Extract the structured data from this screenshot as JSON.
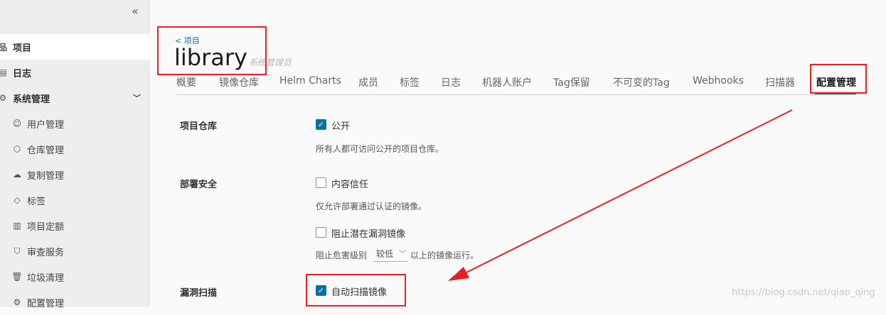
{
  "sidebar": {
    "collapse_icon": "double-chevron-left-icon",
    "items": [
      {
        "label": "项目",
        "icon": "projects-icon",
        "active": true
      },
      {
        "label": "日志",
        "icon": "logs-icon"
      },
      {
        "label": "系统管理",
        "icon": "gears-icon"
      }
    ],
    "sub_items": [
      {
        "label": "用户管理",
        "icon": "users-icon"
      },
      {
        "label": "仓库管理",
        "icon": "cube-icon"
      },
      {
        "label": "复制管理",
        "icon": "cloud-icon"
      },
      {
        "label": "标签",
        "icon": "tag-icon"
      },
      {
        "label": "项目定额",
        "icon": "quota-icon"
      },
      {
        "label": "审查服务",
        "icon": "shield-icon"
      },
      {
        "label": "垃圾清理",
        "icon": "trash-icon"
      },
      {
        "label": "配置管理",
        "icon": "gear-icon"
      }
    ]
  },
  "header": {
    "back_link": "< 项目",
    "title": "library",
    "role": "系统管理员"
  },
  "tabs": [
    {
      "label": "概要"
    },
    {
      "label": "镜像仓库"
    },
    {
      "label": "Helm Charts"
    },
    {
      "label": "成员"
    },
    {
      "label": "标签"
    },
    {
      "label": "日志"
    },
    {
      "label": "机器人账户"
    },
    {
      "label": "Tag保留"
    },
    {
      "label": "不可变的Tag"
    },
    {
      "label": "Webhooks"
    },
    {
      "label": "扫描器"
    },
    {
      "label": "配置管理",
      "active": true
    }
  ],
  "config": {
    "registry": {
      "label": "项目仓库",
      "checkbox_label": "公开",
      "checked": true,
      "help": "所有人都可访问公开的项目仓库。"
    },
    "deployment": {
      "label": "部署安全",
      "trust_label": "内容信任",
      "trust_checked": false,
      "trust_help": "仅允许部署通过认证的镜像。",
      "prevent_label": "阻止潜在漏洞镜像",
      "prevent_checked": false,
      "severity_prefix": "阻止危害级别",
      "severity_value": "较低",
      "severity_suffix": "以上的镜像运行。"
    },
    "scan": {
      "label": "漏洞扫描",
      "checkbox_label": "自动扫描镜像",
      "checked": true
    }
  },
  "watermark": "https://blog.csdn.net/qiao_qing",
  "colors": {
    "accent": "#0072a3",
    "annotation": "#e62020"
  }
}
